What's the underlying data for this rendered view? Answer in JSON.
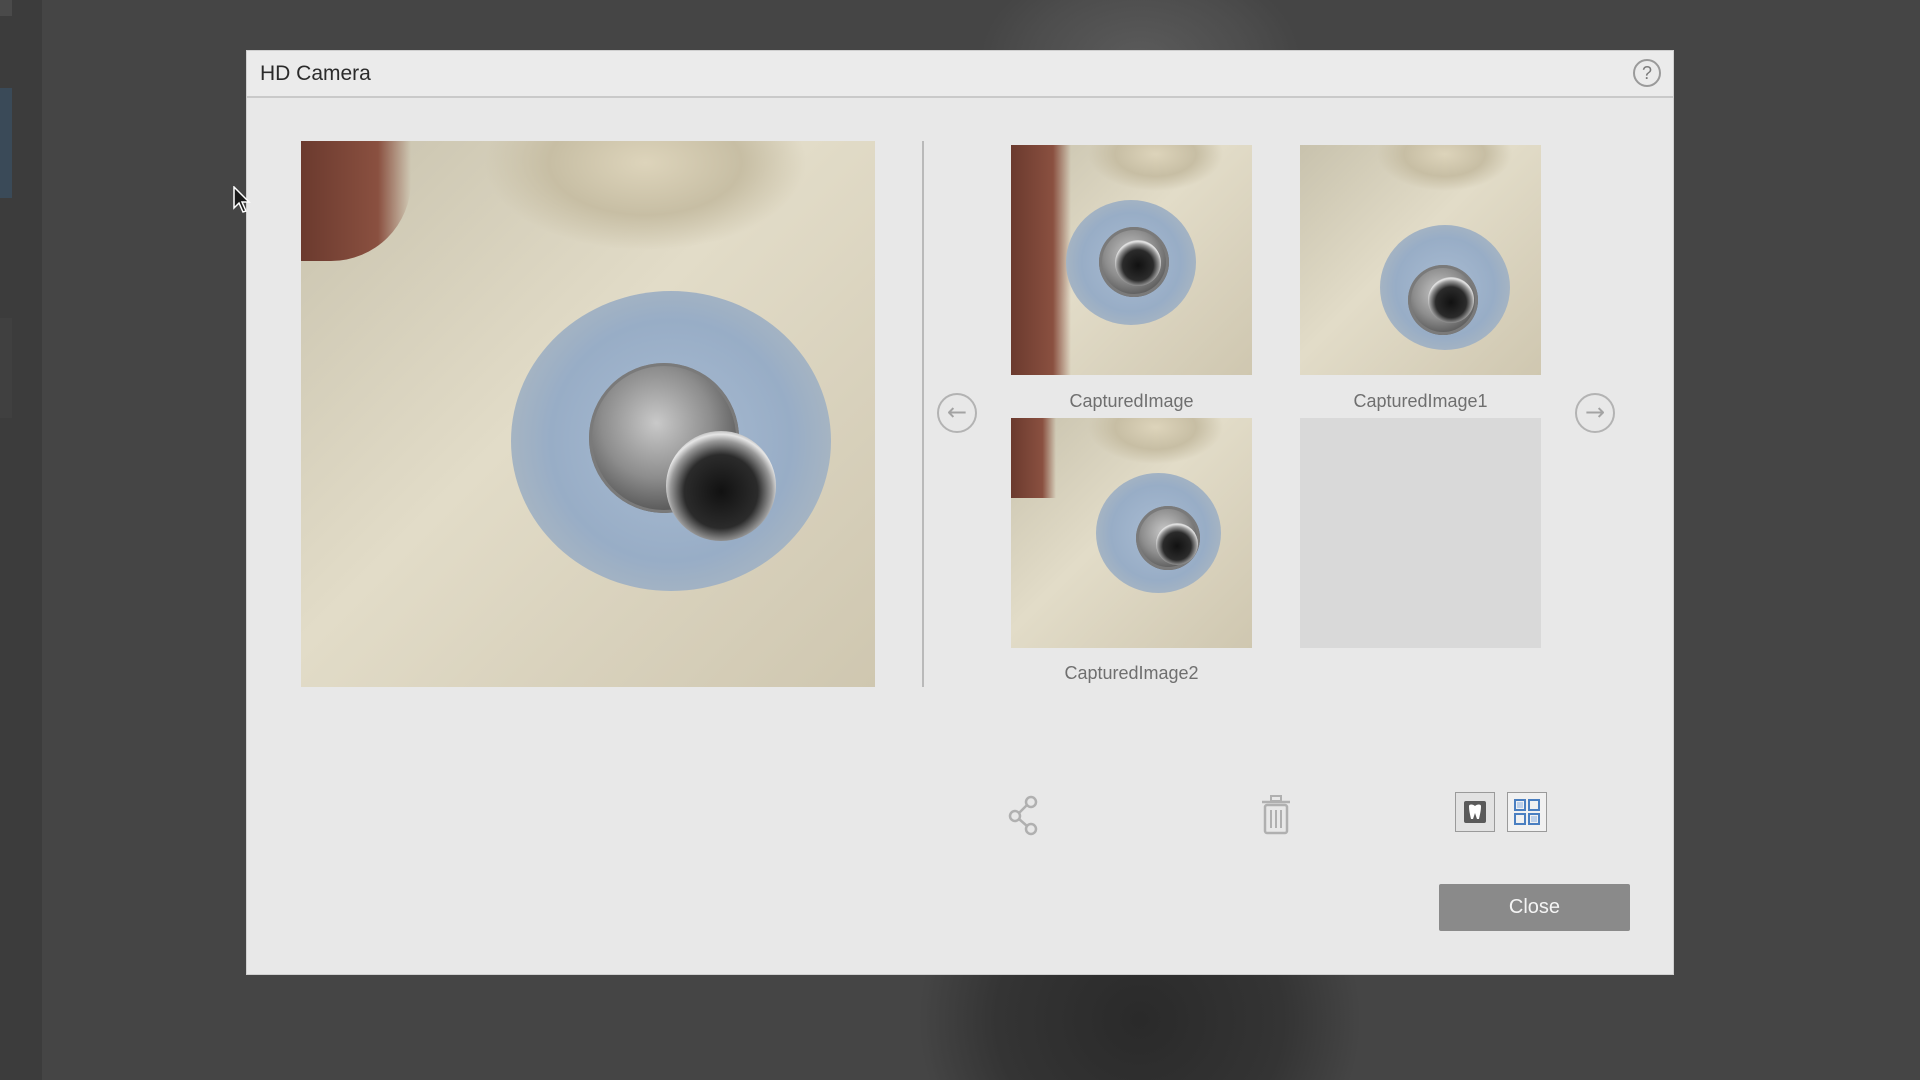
{
  "window": {
    "title": "HD Camera",
    "help_label": "?"
  },
  "gallery": {
    "thumbnails": [
      {
        "caption": "CapturedImage"
      },
      {
        "caption": "CapturedImage1"
      },
      {
        "caption": "CapturedImage2"
      }
    ],
    "prev_label": "←",
    "next_label": "→"
  },
  "toolbar": {
    "share_icon": "share-icon",
    "delete_icon": "trash-icon",
    "single_view_icon": "tooth-icon",
    "grid_view_icon": "grid-icon"
  },
  "footer": {
    "close_label": "Close"
  },
  "colors": {
    "accent_blue": "#4a7fc1",
    "close_button": "#8a8a8a"
  }
}
